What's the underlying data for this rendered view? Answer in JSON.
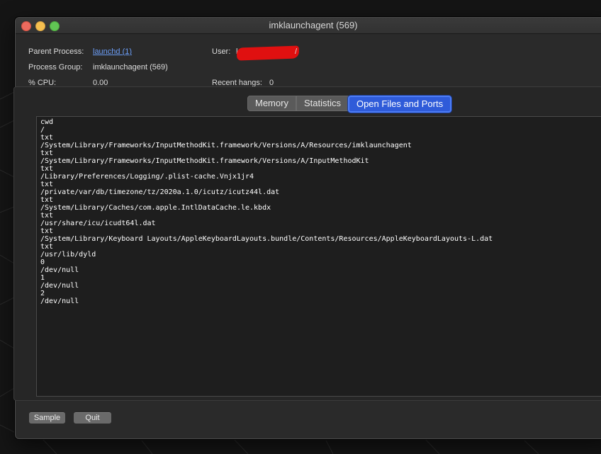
{
  "window": {
    "title": "imklaunchagent (569)"
  },
  "info": {
    "parent_label": "Parent Process:",
    "parent_value": "launchd (1)",
    "user_label": "User:",
    "user_value": "l",
    "user_value_tail": "/",
    "group_label": "Process Group:",
    "group_value": "imklaunchagent (569)",
    "cpu_label": "% CPU:",
    "cpu_value": "0.00",
    "hangs_label": "Recent hangs:",
    "hangs_value": "0"
  },
  "tabs": [
    {
      "label": "Memory",
      "selected": false
    },
    {
      "label": "Statistics",
      "selected": false
    },
    {
      "label": "Open Files and Ports",
      "selected": true
    }
  ],
  "open_files": [
    "cwd",
    "/",
    "txt",
    "/System/Library/Frameworks/InputMethodKit.framework/Versions/A/Resources/imklaunchagent",
    "txt",
    "/System/Library/Frameworks/InputMethodKit.framework/Versions/A/InputMethodKit",
    "txt",
    "/Library/Preferences/Logging/.plist-cache.Vnjx1jr4",
    "txt",
    "/private/var/db/timezone/tz/2020a.1.0/icutz/icutz44l.dat",
    "txt",
    "/System/Library/Caches/com.apple.IntlDataCache.le.kbdx",
    "txt",
    "/usr/share/icu/icudt64l.dat",
    "txt",
    "/System/Library/Keyboard Layouts/AppleKeyboardLayouts.bundle/Contents/Resources/AppleKeyboardLayouts-L.dat",
    "txt",
    "/usr/lib/dyld",
    "0",
    "/dev/null",
    "1",
    "/dev/null",
    "2",
    "/dev/null"
  ],
  "buttons": {
    "sample": "Sample",
    "quit": "Quit"
  },
  "colors": {
    "accent": "#2f5bd9",
    "link": "#6c9ef8",
    "redaction": "#e01010"
  }
}
